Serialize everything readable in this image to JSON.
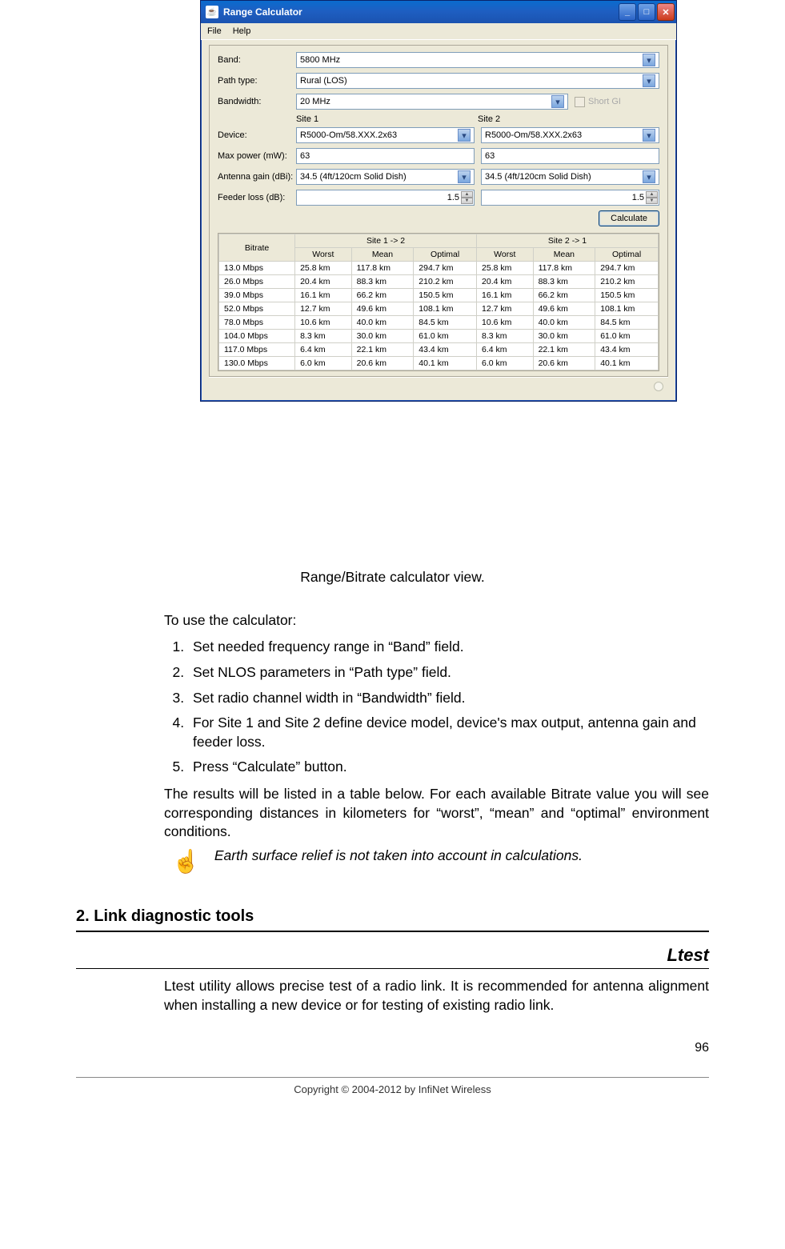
{
  "window": {
    "title": "Range Calculator",
    "menu": {
      "file": "File",
      "help": "Help"
    },
    "labels": {
      "band": "Band:",
      "path_type": "Path type:",
      "bandwidth": "Bandwidth:",
      "short_gi": "Short GI",
      "site1": "Site 1",
      "site2": "Site 2",
      "device": "Device:",
      "max_power": "Max power (mW):",
      "antenna": "Antenna gain (dBi):",
      "feeder": "Feeder loss (dB):",
      "calculate": "Calculate"
    },
    "values": {
      "band": "5800 MHz",
      "path_type": "Rural (LOS)",
      "bandwidth": "20 MHz",
      "s1": {
        "device": "R5000-Om/58.XXX.2x63",
        "power": "63",
        "antenna": "34.5 (4ft/120cm Solid Dish)",
        "feeder": "1.5"
      },
      "s2": {
        "device": "R5000-Om/58.XXX.2x63",
        "power": "63",
        "antenna": "34.5 (4ft/120cm Solid Dish)",
        "feeder": "1.5"
      }
    },
    "table": {
      "h_bitrate": "Bitrate",
      "h_s12": "Site 1 -> 2",
      "h_s21": "Site 2 -> 1",
      "h_worst": "Worst",
      "h_mean": "Mean",
      "h_opt": "Optimal",
      "rows": [
        {
          "b": "13.0 Mbps",
          "w1": "25.8 km",
          "m1": "117.8 km",
          "o1": "294.7 km",
          "w2": "25.8 km",
          "m2": "117.8 km",
          "o2": "294.7 km"
        },
        {
          "b": "26.0 Mbps",
          "w1": "20.4 km",
          "m1": "88.3 km",
          "o1": "210.2 km",
          "w2": "20.4 km",
          "m2": "88.3 km",
          "o2": "210.2 km"
        },
        {
          "b": "39.0 Mbps",
          "w1": "16.1 km",
          "m1": "66.2 km",
          "o1": "150.5 km",
          "w2": "16.1 km",
          "m2": "66.2 km",
          "o2": "150.5 km"
        },
        {
          "b": "52.0 Mbps",
          "w1": "12.7 km",
          "m1": "49.6 km",
          "o1": "108.1 km",
          "w2": "12.7 km",
          "m2": "49.6 km",
          "o2": "108.1 km"
        },
        {
          "b": "78.0 Mbps",
          "w1": "10.6 km",
          "m1": "40.0 km",
          "o1": "84.5 km",
          "w2": "10.6 km",
          "m2": "40.0 km",
          "o2": "84.5 km"
        },
        {
          "b": "104.0 Mbps",
          "w1": "8.3 km",
          "m1": "30.0 km",
          "o1": "61.0 km",
          "w2": "8.3 km",
          "m2": "30.0 km",
          "o2": "61.0 km"
        },
        {
          "b": "117.0 Mbps",
          "w1": "6.4 km",
          "m1": "22.1 km",
          "o1": "43.4 km",
          "w2": "6.4 km",
          "m2": "22.1 km",
          "o2": "43.4 km"
        },
        {
          "b": "130.0 Mbps",
          "w1": "6.0 km",
          "m1": "20.6 km",
          "o1": "40.1 km",
          "w2": "6.0 km",
          "m2": "20.6 km",
          "o2": "40.1 km"
        }
      ]
    }
  },
  "doc": {
    "caption": "Range/Bitrate calculator view.",
    "lead": "To use the calculator:",
    "steps": [
      "Set needed frequency range in “Band” field.",
      "Set NLOS parameters in “Path type” field.",
      "Set radio channel width in “Bandwidth” field.",
      "For Site 1 and Site 2 define device model, device's max output, antenna gain and feeder loss.",
      "Press “Calculate” button."
    ],
    "results": "The results will be listed in a table below. For each available Bitrate value you will see corresponding distances in kilometers for “worst”, “mean” and “optimal” environment conditions.",
    "note": "Earth surface relief is not taken into account in calculations.",
    "section": "2. Link diagnostic tools",
    "ltest_hdr": "Ltest",
    "ltest_body": "Ltest utility allows precise test of a radio link. It is recommended for antenna alignment when installing a new device or for testing of existing radio link.",
    "page": "96",
    "copyright": "Copyright © 2004-2012 by InfiNet Wireless"
  }
}
